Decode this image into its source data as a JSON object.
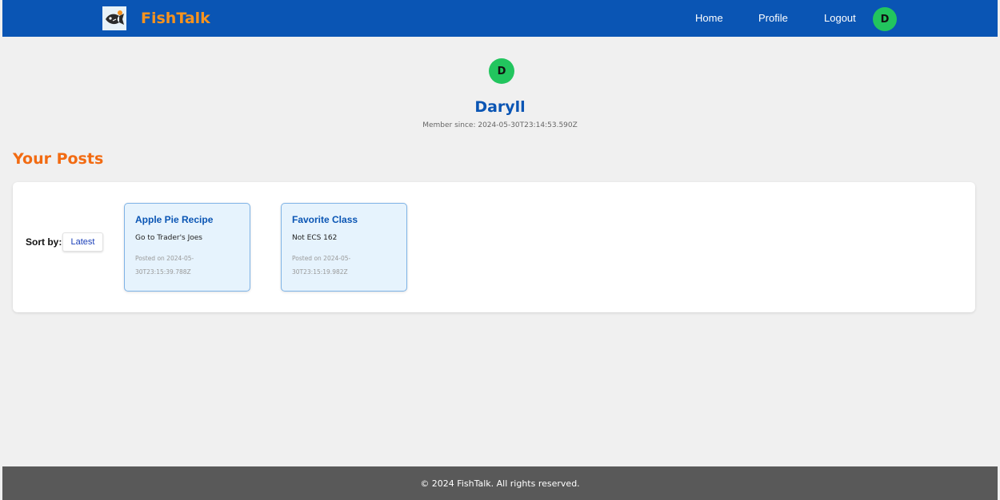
{
  "header": {
    "brand": "FishTalk",
    "nav": {
      "home": "Home",
      "profile": "Profile",
      "logout": "Logout"
    },
    "avatar_initial": "D"
  },
  "profile": {
    "avatar_initial": "D",
    "name": "Daryll",
    "member_since": "Member since: 2024-05-30T23:14:53.590Z"
  },
  "posts_section": {
    "title": "Your Posts",
    "sort_label": "Sort by:",
    "sort_value": "Latest",
    "posts": [
      {
        "title": "Apple Pie Recipe",
        "body": "Go to Trader's Joes",
        "date": "Posted on 2024-05-30T23:15:39.788Z"
      },
      {
        "title": "Favorite Class",
        "body": "Not ECS 162",
        "date": "Posted on 2024-05-30T23:15:19.982Z"
      }
    ]
  },
  "footer": {
    "text": "© 2024 FishTalk. All rights reserved."
  },
  "colors": {
    "nav_bg": "#0a55b4",
    "brand": "#f7931e",
    "section_title": "#f26b12",
    "avatar": "#22c55e",
    "card_bg": "#e6f3fd",
    "footer_bg": "#595959"
  },
  "icons": {
    "logo": "fish-logo-icon"
  }
}
